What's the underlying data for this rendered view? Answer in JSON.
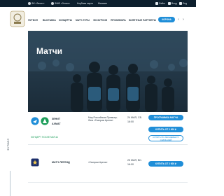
{
  "topbar": {
    "items": [
      "ФК «Зенит»",
      "ФМФ «Зенит»",
      "Клубная карта",
      "Магазин"
    ],
    "right": [
      "Фэйм",
      "Вход",
      "Eng"
    ]
  },
  "nav": {
    "items": [
      "ФУТБОЛ",
      "ВЫСТАВКА",
      "КОНЦЕРТЫ",
      "МАТЧ-ТУРЫ",
      "ЭКСКУРСИИ",
      "ПРОЖИВОЛЬ",
      "БИЛЕТНЫЕ ПАРТНЕРЫ"
    ],
    "corona_label": "КОРОНА"
  },
  "hero": {
    "title": "Матчи"
  },
  "sidebar": {
    "vertical_label": "ФУТБОЛ"
  },
  "matches": [
    {
      "home": "ЗЕНИТ",
      "away": "АХМАТ",
      "venue": "Мир Российская Премьер-Лига «Газпром Арена»",
      "date": "24 МАЯ, СБ.",
      "time": "16:00",
      "program_label": "ПРОГРАММКА МАТЧА",
      "buy_label": "КУПИТЬ ОТ 2 000 ₽",
      "sub_label": "КУПИТЬ ПО АБОНЕМЕНТУ СЕЗОННЫЙ",
      "extra_link": "КОНЦЕРТ ПОСЛЕ МАТЧА"
    },
    {
      "title": "МАТЧ ЛЕГЕНД",
      "venue": "«Газпром Арена»",
      "date": "25 МАЯ, ВС.",
      "time": "16:00",
      "buy_label": "КУПИТЬ ОТ 2 000 ₽"
    }
  ],
  "colors": {
    "brand": "#1f8ed8",
    "topbar": "#0d1f2d",
    "hero": "#253a4a",
    "akhmat": "#1d9e5a"
  }
}
